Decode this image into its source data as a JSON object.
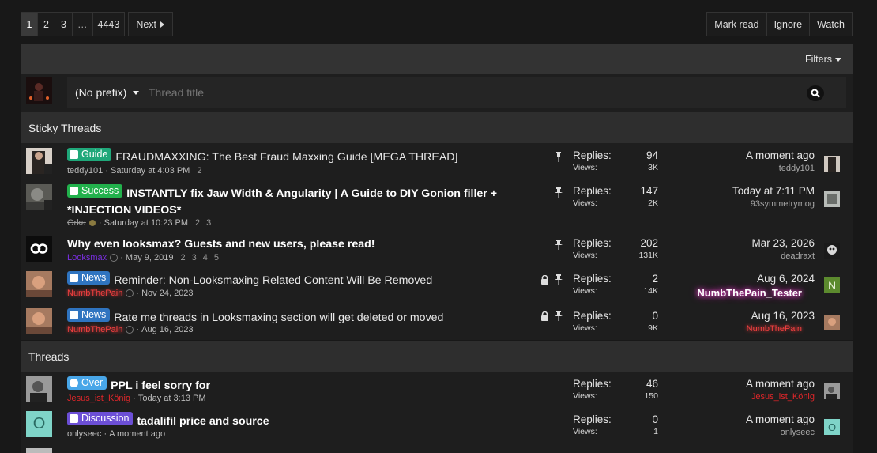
{
  "pagination": {
    "pages": [
      "1",
      "2",
      "3",
      "…",
      "4443"
    ],
    "active": "1",
    "next_label": "Next"
  },
  "actions": {
    "mark_read": "Mark read",
    "ignore": "Ignore",
    "watch": "Watch"
  },
  "filters_label": "Filters",
  "new_thread": {
    "prefix": "(No prefix)",
    "placeholder": "Thread title"
  },
  "sections": {
    "sticky": "Sticky Threads",
    "threads": "Threads"
  },
  "colors": {
    "guide": "#1fa87a",
    "success": "#22b14c",
    "news": "#2f74c0",
    "over": "#48a6e8",
    "discussion": "#6c4fd6",
    "username_red": "#e0262a",
    "username_purple": "#7b2fe3"
  },
  "sticky_threads": [
    {
      "badge": "Guide",
      "title": "FRAUDMAXXING: The Best Fraud Maxxing Guide [MEGA THREAD]",
      "author": "teddy101",
      "date": "Saturday at 4:03 PM",
      "pages": [
        "2"
      ],
      "replies_label": "Replies:",
      "replies": "94",
      "views_label": "Views:",
      "views": "3K",
      "last_time": "A moment ago",
      "last_user": "teddy101"
    },
    {
      "badge": "Success",
      "title": "INSTANTLY fix Jaw Width & Angularity | A Guide to DIY Gonion filler + *INJECTION VIDEOS*",
      "author": "Orka",
      "date": "Saturday at 10:23 PM",
      "pages": [
        "2",
        "3"
      ],
      "replies_label": "Replies:",
      "replies": "147",
      "views_label": "Views:",
      "views": "2K",
      "last_time": "Today at 7:11 PM",
      "last_user": "93symmetrymog"
    },
    {
      "badge": "",
      "title": "Why even looksmax? Guests and new users, please read!",
      "author": "Looksmax",
      "date": "May 9, 2019",
      "pages": [
        "2",
        "3",
        "4",
        "5"
      ],
      "replies_label": "Replies:",
      "replies": "202",
      "views_label": "Views:",
      "views": "131K",
      "last_time": "Mar 23, 2026",
      "last_user": "deadraxt"
    },
    {
      "badge": "News",
      "title": "Reminder: Non-Looksmaxing Related Content Will Be Removed",
      "author": "NumbThePain",
      "date": "Nov 24, 2023",
      "pages": [],
      "replies_label": "Replies:",
      "replies": "2",
      "views_label": "Views:",
      "views": "14K",
      "last_time": "Aug 6, 2024",
      "last_user": "NumbThePain_Tester"
    },
    {
      "badge": "News",
      "title": "Rate me threads in Looksmaxing section will get deleted or moved",
      "author": "NumbThePain",
      "date": "Aug 16, 2023",
      "pages": [],
      "replies_label": "Replies:",
      "replies": "0",
      "views_label": "Views:",
      "views": "9K",
      "last_time": "Aug 16, 2023",
      "last_user": "NumbThePain"
    }
  ],
  "threads": [
    {
      "badge": "Over",
      "title": "PPL i feel sorry for",
      "author": "Jesus_ist_König",
      "date": "Today at 3:13 PM",
      "replies_label": "Replies:",
      "replies": "46",
      "views_label": "Views:",
      "views": "150",
      "last_time": "A moment ago",
      "last_user": "Jesus_ist_König",
      "avatar_letter": ""
    },
    {
      "badge": "Discussion",
      "title": "tadalifil price and source",
      "author": "onlyseec",
      "date": "A moment ago",
      "replies_label": "Replies:",
      "replies": "0",
      "views_label": "Views:",
      "views": "1",
      "last_time": "A moment ago",
      "last_user": "onlyseec",
      "avatar_letter": "O"
    }
  ],
  "last_avatar_letters": {
    "tester": "N",
    "onlyseec": "O"
  }
}
